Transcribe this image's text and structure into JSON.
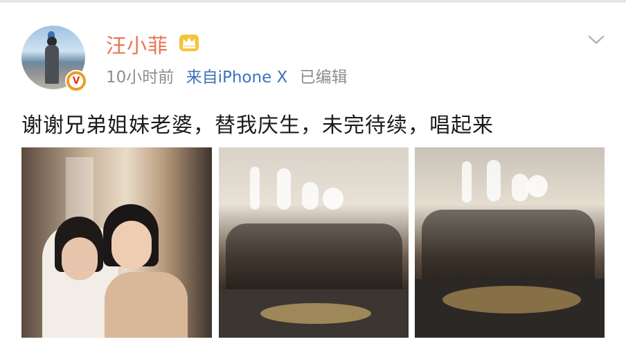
{
  "post": {
    "username": "汪小菲",
    "meta": {
      "time": "10小时前",
      "source": "来自iPhone X",
      "edited": "已编辑"
    },
    "text": "谢谢兄弟姐妹老婆，替我庆生，未完待续，唱起来",
    "badge_letter": "V"
  },
  "colors": {
    "username": "#eb7350",
    "meta": "#8e8e8e",
    "source_link": "#3d72b8",
    "text": "#1a1a1a",
    "verified_badge": "#f29a1f",
    "crown": "#f0b21d"
  },
  "icons": {
    "avatar": "profile-photo",
    "verified": "verified-v-badge",
    "vip": "crown-icon",
    "menu": "chevron-down-icon"
  },
  "photos": [
    {
      "name": "photo-couple-hug"
    },
    {
      "name": "photo-group-dinner-1"
    },
    {
      "name": "photo-group-dinner-2"
    }
  ]
}
